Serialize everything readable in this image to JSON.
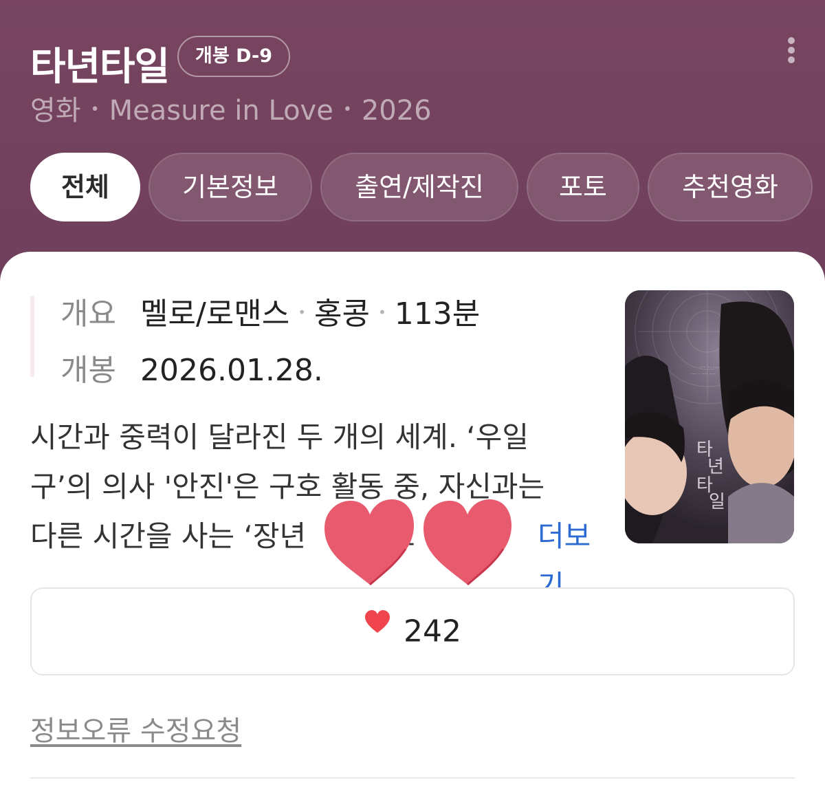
{
  "header": {
    "title": "타년타일",
    "badge": "개봉 D-9",
    "subtitle": {
      "category": "영화",
      "original_title": "Measure in Love",
      "year": "2026"
    }
  },
  "tabs": [
    {
      "label": "전체",
      "active": true
    },
    {
      "label": "기본정보",
      "active": false
    },
    {
      "label": "출연/제작진",
      "active": false
    },
    {
      "label": "포토",
      "active": false
    },
    {
      "label": "추천영화",
      "active": false
    }
  ],
  "info": {
    "summary_label": "개요",
    "genre": "멜로/로맨스",
    "country": "홍콩",
    "runtime": "113분",
    "release_label": "개봉",
    "release_date": "2026.01.28."
  },
  "synopsis": {
    "line1": "시간과 중력이 달라진 두 개의 세계. ‘우일",
    "line2": "구’의 의사 '안진'은 구호 활동 중, 자신과는",
    "line3_prefix": "다른 시간을 사는 ‘장년",
    "line3_suffix": "쇼",
    "more_label": "더보기"
  },
  "like": {
    "count": "242",
    "icon": "heart-icon"
  },
  "report_link": "정보오류 수정요청",
  "colors": {
    "header_bg": "#74425f",
    "link": "#2d6bd3",
    "like_heart": "#f0454f",
    "sticker_heart": "#e95a6f"
  }
}
